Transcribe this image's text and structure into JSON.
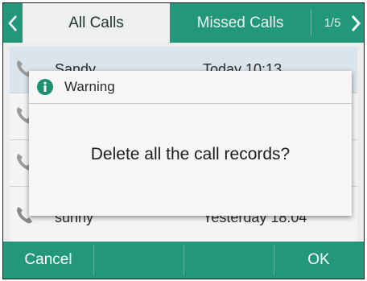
{
  "tabs": {
    "active_label": "All Calls",
    "missed_label": "Missed Calls",
    "page_indicator": "1/5"
  },
  "call_list": [
    {
      "name": "Sandy",
      "time": "Today 10:13",
      "selected": true
    },
    {
      "name": "",
      "time": "",
      "selected": false
    },
    {
      "name": "",
      "time": "",
      "selected": false
    },
    {
      "name": "sunny",
      "time": "Yesterday 18:04",
      "selected": false
    }
  ],
  "dialog": {
    "title": "Warning",
    "message": "Delete all the call records?",
    "icon": "info-icon"
  },
  "softkeys": {
    "cancel_label": "Cancel",
    "ok_label": "OK"
  },
  "colors": {
    "accent": "#22977a",
    "active_tab": "#eef0ef",
    "selected_row": "#d9e4ec"
  }
}
